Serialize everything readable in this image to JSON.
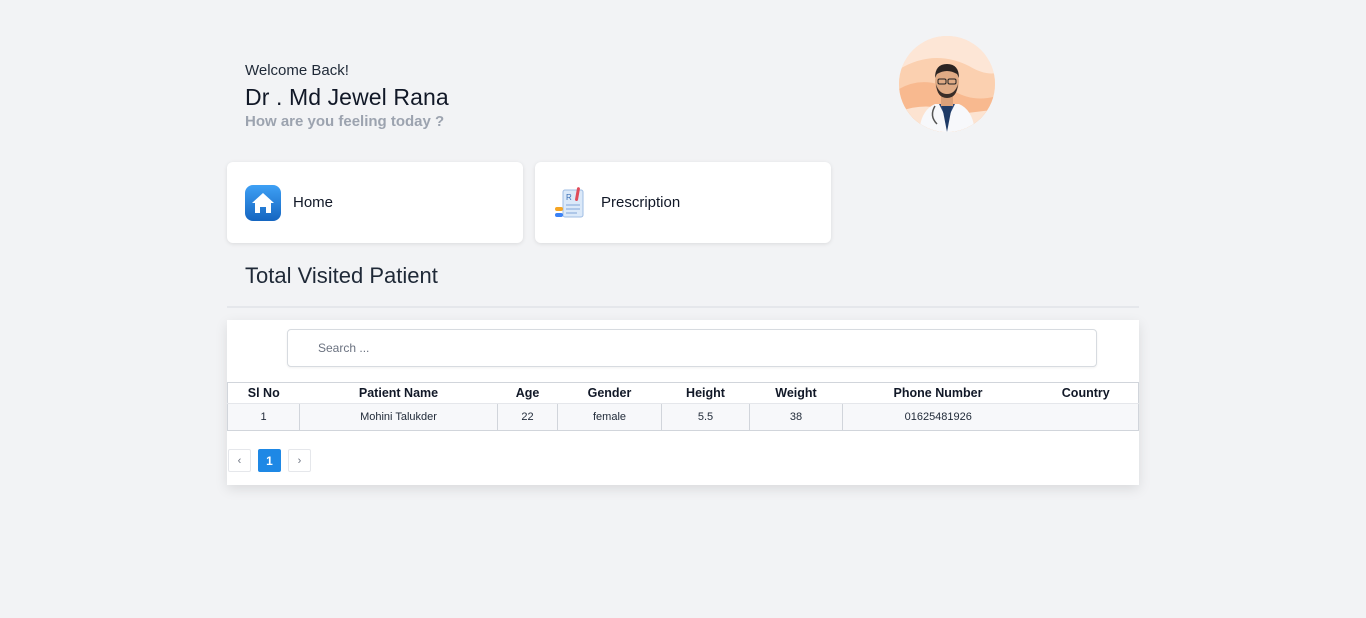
{
  "header": {
    "welcome": "Welcome Back!",
    "doctor_name": "Dr . Md Jewel Rana",
    "question": "How are you feeling today ?"
  },
  "nav": {
    "home_label": "Home",
    "prescription_label": "Prescription",
    "home_icon": "house-icon",
    "prescription_icon": "prescription-icon"
  },
  "section": {
    "title": "Total Visited Patient"
  },
  "search": {
    "placeholder": "Search ...",
    "value": ""
  },
  "table": {
    "columns": [
      "Sl No",
      "Patient Name",
      "Age",
      "Gender",
      "Height",
      "Weight",
      "Phone Number",
      "Country"
    ],
    "rows": [
      [
        "1",
        "Mohini Talukder",
        "22",
        "female",
        "5.5",
        "38",
        "01625481926",
        ""
      ]
    ]
  },
  "pagination": {
    "prev": "‹",
    "current": "1",
    "next": "›"
  },
  "colors": {
    "accent": "#1e88e5",
    "background": "#f2f3f5",
    "muted": "#9ca3af"
  }
}
